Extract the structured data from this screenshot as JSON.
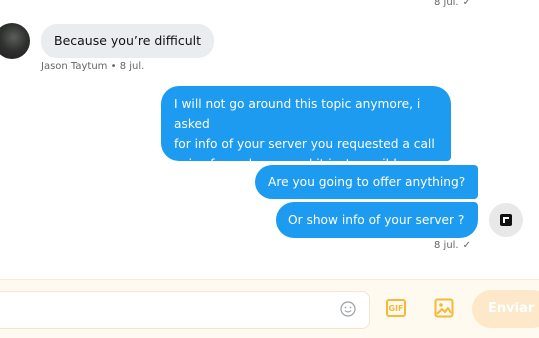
{
  "messages": [
    {
      "id": "m0",
      "direction": "out",
      "time": "8 jul."
    },
    {
      "id": "m1",
      "direction": "in",
      "text": "Because you’re difficult",
      "sender": "Jason Taytum",
      "time": "8 jul."
    },
    {
      "id": "m2",
      "direction": "out",
      "lines": [
        "I will not go around this topic anymore, i asked",
        "for info of your server you requested a call",
        "voice from skeppy and it isnt possible"
      ]
    },
    {
      "id": "m3",
      "direction": "out",
      "text": "Are you going to offer anything?"
    },
    {
      "id": "m4",
      "direction": "out",
      "text": "Or show info of your server ?",
      "time": "8 jul."
    }
  ],
  "sender_separator": "•",
  "read_check": "✓",
  "composer": {
    "placeholder": "",
    "gif_label": "GIF",
    "send_label": "Enviar"
  },
  "icons": {
    "emoji": "smiley-icon",
    "gif": "gif-icon",
    "image": "image-icon",
    "my_avatar": "app-badge-icon"
  },
  "colors": {
    "outgoing_bubble": "#1d9bf0",
    "incoming_bubble": "#e9edf0",
    "composer_bg": "#fffaf0",
    "accent_icon": "#f5b83b",
    "send_disabled": "#fde9c9"
  }
}
